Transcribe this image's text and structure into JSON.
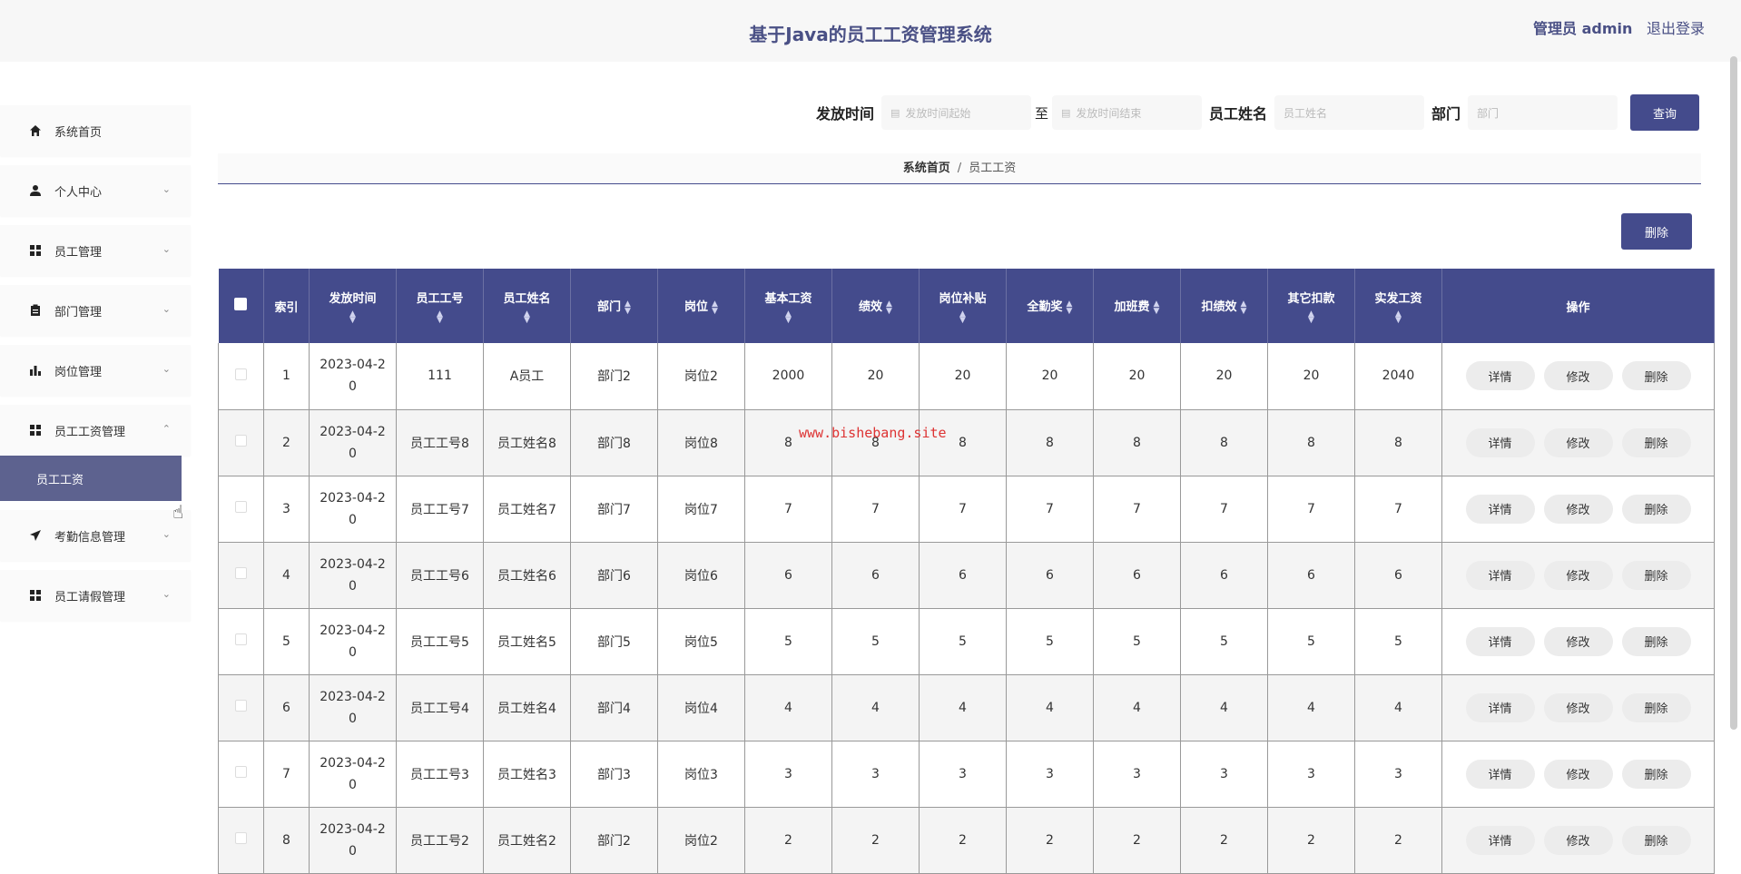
{
  "header": {
    "title": "基于Java的员工工资管理系统",
    "role": "管理员 admin",
    "logout": "退出登录"
  },
  "sidebar": {
    "items": [
      {
        "label": "系统首页",
        "icon": "home-icon"
      },
      {
        "label": "个人中心",
        "icon": "user-icon"
      },
      {
        "label": "员工管理",
        "icon": "grid-icon"
      },
      {
        "label": "部门管理",
        "icon": "clipboard-icon"
      },
      {
        "label": "岗位管理",
        "icon": "bar-chart-icon"
      },
      {
        "label": "员工工资管理",
        "icon": "grid-icon"
      },
      {
        "label": "考勤信息管理",
        "icon": "send-icon"
      },
      {
        "label": "员工请假管理",
        "icon": "grid-icon"
      }
    ],
    "active_sub": "员工工资"
  },
  "search": {
    "date_label": "发放时间",
    "date_start_placeholder": "发放时间起始",
    "to": "至",
    "date_end_placeholder": "发放时间结束",
    "name_label": "员工姓名",
    "name_placeholder": "员工姓名",
    "dept_label": "部门",
    "dept_placeholder": "部门",
    "query_button": "查询"
  },
  "breadcrumb": {
    "home": "系统首页",
    "sep": "/",
    "current": "员工工资"
  },
  "actions": {
    "delete": "删除"
  },
  "table": {
    "headers": [
      "索引",
      "发放时间",
      "员工工号",
      "员工姓名",
      "部门",
      "岗位",
      "基本工资",
      "绩效",
      "岗位补贴",
      "全勤奖",
      "加班费",
      "扣绩效",
      "其它扣款",
      "实发工资",
      "操作"
    ],
    "row_actions": {
      "detail": "详情",
      "edit": "修改",
      "delete": "删除"
    },
    "rows": [
      {
        "index": "1",
        "date_a": "2023-04-2",
        "date_b": "0",
        "emp_no": "111",
        "emp_name": "A员工",
        "dept": "部门2",
        "post": "岗位2",
        "base": "2000",
        "perf": "20",
        "subsidy": "20",
        "attend": "20",
        "overtime": "20",
        "perf_ded": "20",
        "other_ded": "20",
        "net": "2040"
      },
      {
        "index": "2",
        "date_a": "2023-04-2",
        "date_b": "0",
        "emp_no": "员工工号8",
        "emp_name": "员工姓名8",
        "dept": "部门8",
        "post": "岗位8",
        "base": "8",
        "perf": "8",
        "subsidy": "8",
        "attend": "8",
        "overtime": "8",
        "perf_ded": "8",
        "other_ded": "8",
        "net": "8"
      },
      {
        "index": "3",
        "date_a": "2023-04-2",
        "date_b": "0",
        "emp_no": "员工工号7",
        "emp_name": "员工姓名7",
        "dept": "部门7",
        "post": "岗位7",
        "base": "7",
        "perf": "7",
        "subsidy": "7",
        "attend": "7",
        "overtime": "7",
        "perf_ded": "7",
        "other_ded": "7",
        "net": "7"
      },
      {
        "index": "4",
        "date_a": "2023-04-2",
        "date_b": "0",
        "emp_no": "员工工号6",
        "emp_name": "员工姓名6",
        "dept": "部门6",
        "post": "岗位6",
        "base": "6",
        "perf": "6",
        "subsidy": "6",
        "attend": "6",
        "overtime": "6",
        "perf_ded": "6",
        "other_ded": "6",
        "net": "6"
      },
      {
        "index": "5",
        "date_a": "2023-04-2",
        "date_b": "0",
        "emp_no": "员工工号5",
        "emp_name": "员工姓名5",
        "dept": "部门5",
        "post": "岗位5",
        "base": "5",
        "perf": "5",
        "subsidy": "5",
        "attend": "5",
        "overtime": "5",
        "perf_ded": "5",
        "other_ded": "5",
        "net": "5"
      },
      {
        "index": "6",
        "date_a": "2023-04-2",
        "date_b": "0",
        "emp_no": "员工工号4",
        "emp_name": "员工姓名4",
        "dept": "部门4",
        "post": "岗位4",
        "base": "4",
        "perf": "4",
        "subsidy": "4",
        "attend": "4",
        "overtime": "4",
        "perf_ded": "4",
        "other_ded": "4",
        "net": "4"
      },
      {
        "index": "7",
        "date_a": "2023-04-2",
        "date_b": "0",
        "emp_no": "员工工号3",
        "emp_name": "员工姓名3",
        "dept": "部门3",
        "post": "岗位3",
        "base": "3",
        "perf": "3",
        "subsidy": "3",
        "attend": "3",
        "overtime": "3",
        "perf_ded": "3",
        "other_ded": "3",
        "net": "3"
      },
      {
        "index": "8",
        "date_a": "2023-04-2",
        "date_b": "0",
        "emp_no": "员工工号2",
        "emp_name": "员工姓名2",
        "dept": "部门2",
        "post": "岗位2",
        "base": "2",
        "perf": "2",
        "subsidy": "2",
        "attend": "2",
        "overtime": "2",
        "perf_ded": "2",
        "other_ded": "2",
        "net": "2"
      }
    ]
  },
  "watermark": "www.bishebang.site",
  "colors": {
    "primary": "#444b8c",
    "active_menu": "#5d628f",
    "title": "#4a5085"
  }
}
